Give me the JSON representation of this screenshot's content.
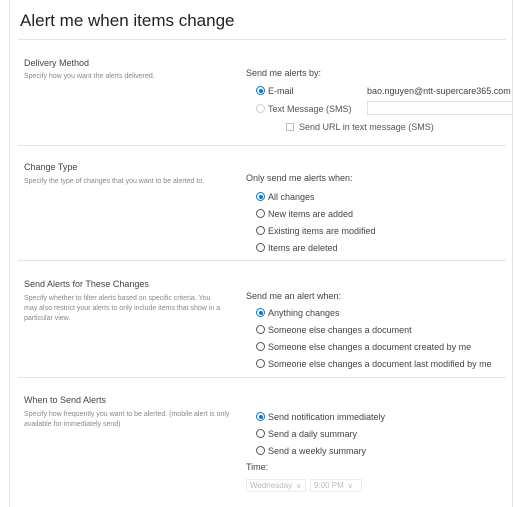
{
  "page": {
    "title": "Alert me when items change"
  },
  "delivery": {
    "heading": "Delivery Method",
    "description": "Specify how you want the alerts delivered.",
    "prompt": "Send me alerts by:",
    "email_label": "E-mail",
    "email_value": "bao.nguyen@ntt-supercare365.com",
    "sms_label": "Text Message (SMS)",
    "sms_url_label": "Send URL in text message (SMS)"
  },
  "change_type": {
    "heading": "Change Type",
    "description": "Specify the type of changes that you want to be alerted to.",
    "prompt": "Only send me alerts when:",
    "options": [
      "All changes",
      "New items are added",
      "Existing items are modified",
      "Items are deleted"
    ],
    "selected": 0
  },
  "filter": {
    "heading": "Send Alerts for These Changes",
    "description": "Specify whether to filter alerts based on specific criteria. You may also restrict your alerts to only include items that show in a particular view.",
    "prompt": "Send me an alert when:",
    "options": [
      "Anything changes",
      "Someone else changes a document",
      "Someone else changes a document created by me",
      "Someone else changes a document last modified by me"
    ],
    "selected": 0
  },
  "when": {
    "heading": "When to Send Alerts",
    "description": "Specify how frequently you want to be alerted. (mobile alert is only available for immediately send)",
    "options": [
      "Send notification immediately",
      "Send a daily summary",
      "Send a weekly summary"
    ],
    "selected": 0,
    "time_label": "Time:",
    "day_value": "Wednesday",
    "time_value": "9:00 PM"
  },
  "colors": {
    "accent": "#0078d4",
    "muted_text": "#888888",
    "disabled": "#bbbbbb"
  },
  "icons": {
    "dropdown": "chevron-down-icon"
  }
}
